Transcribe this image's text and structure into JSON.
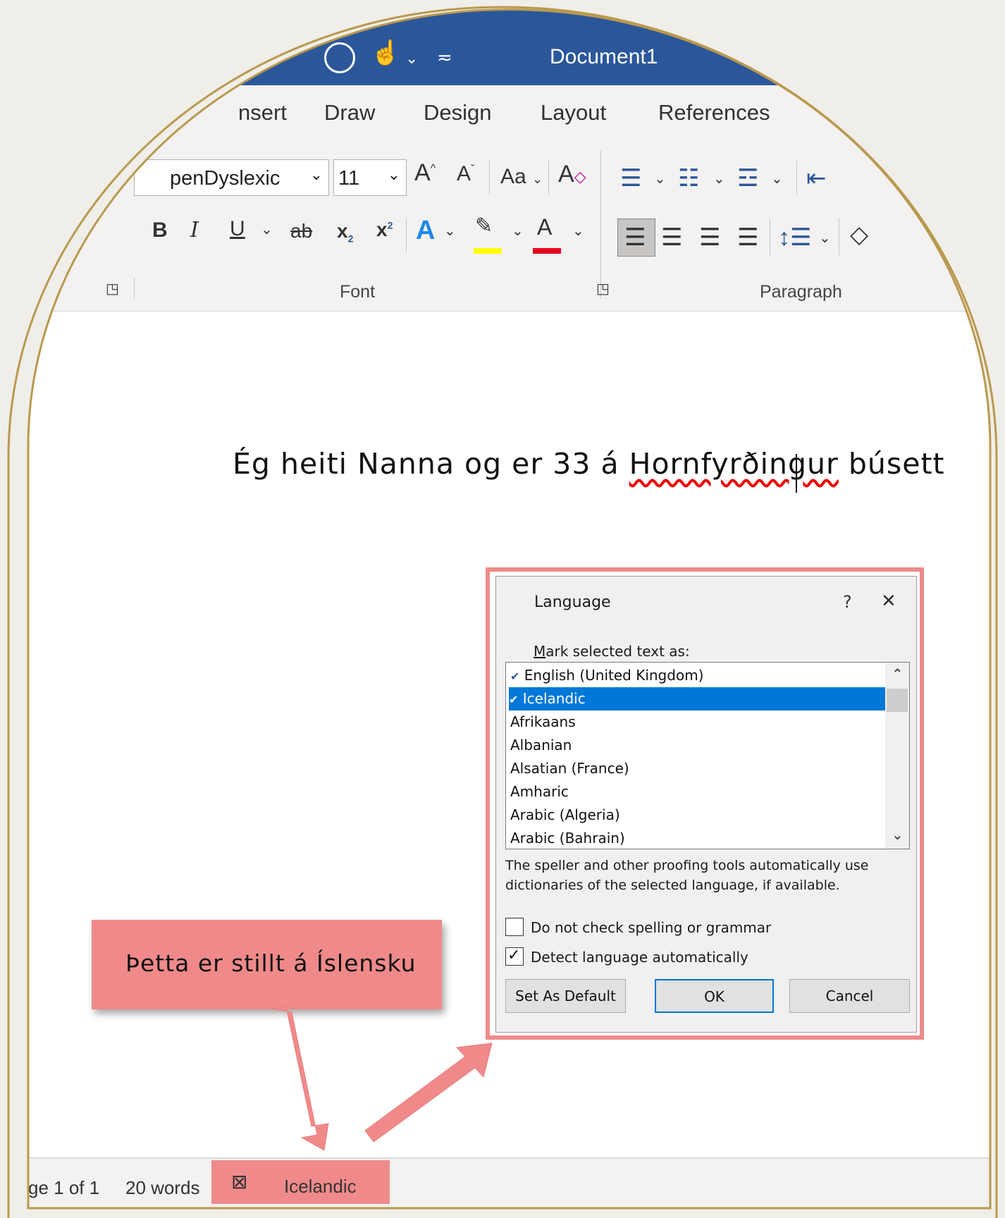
{
  "titlebar": {
    "document_title": "Document1"
  },
  "ribbon": {
    "tabs": [
      "nsert",
      "Draw",
      "Design",
      "Layout",
      "References"
    ],
    "font_name": "penDyslexic",
    "font_size": "11",
    "change_case": "Aa",
    "font_group_label": "Font",
    "paragraph_group_label": "Paragraph"
  },
  "document": {
    "text_before": "Ég heiti Nanna og er 33 á ",
    "misspelled": "Hornfyrðingur",
    "text_after": " búsett"
  },
  "dialog": {
    "title": "Language",
    "help": "?",
    "close": "✕",
    "mark_label_prefix": "M",
    "mark_label_rest": "ark selected text as:",
    "languages": [
      "English (United Kingdom)",
      "Icelandic",
      "Afrikaans",
      "Albanian",
      "Alsatian (France)",
      "Amharic",
      "Arabic (Algeria)",
      "Arabic (Bahrain)"
    ],
    "selected_language": "Icelandic",
    "info_line1": "The speller and other proofing tools automatically use",
    "info_line2": "dictionaries of the selected language, if available.",
    "no_check_label": "Do not check spelling or grammar",
    "no_check_checked": false,
    "detect_label": "Detect language automatically",
    "detect_checked": true,
    "set_default_button": "Set As Default",
    "ok_button": "OK",
    "cancel_button": "Cancel"
  },
  "callout": {
    "text": "Þetta er stillt á Íslensku"
  },
  "statusbar": {
    "page": "ge 1 of 1",
    "words": "20 words",
    "language": "Icelandic"
  },
  "colors": {
    "word_blue": "#2b579a",
    "highlight_pink": "#f08a8a",
    "selection_blue": "#0078d7",
    "frame_gold": "#b9994f"
  }
}
